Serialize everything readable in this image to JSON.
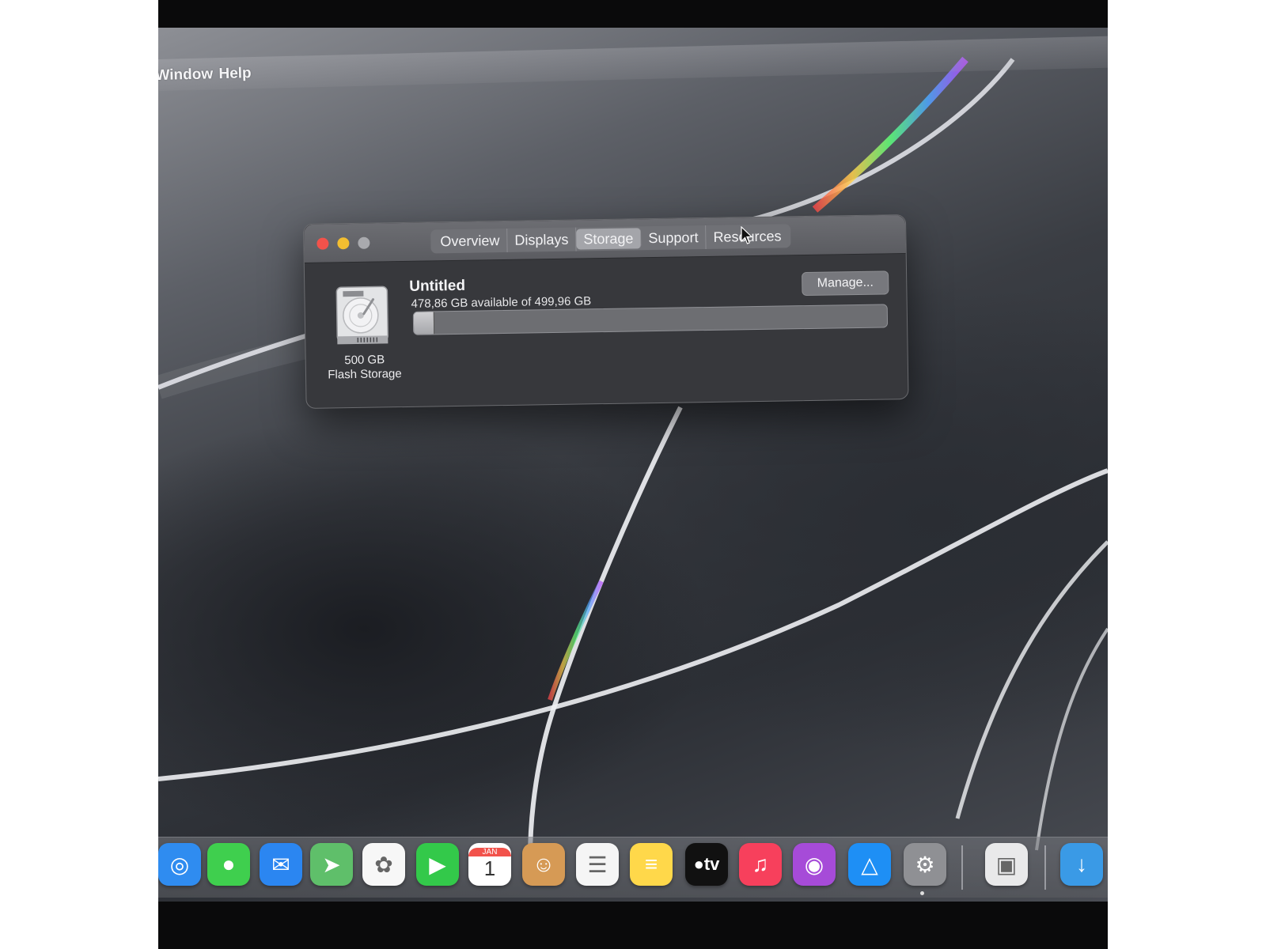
{
  "menubar": {
    "items": [
      "Window",
      "Help"
    ]
  },
  "window": {
    "tabs": [
      {
        "label": "Overview"
      },
      {
        "label": "Displays"
      },
      {
        "label": "Storage"
      },
      {
        "label": "Support"
      },
      {
        "label": "Resources"
      }
    ],
    "active_tab": "Storage",
    "disk": {
      "size_label": "500 GB",
      "type_label": "Flash Storage",
      "icon": "hard-drive-icon"
    },
    "volume": {
      "name": "Untitled",
      "availability": "478,86 GB available of 499,96 GB",
      "used_fraction": 0.042
    },
    "manage_label": "Manage..."
  },
  "dock": {
    "apps": [
      {
        "name": "safari-icon",
        "color": "#2f8cf0"
      },
      {
        "name": "messages-icon",
        "color": "#3fcf4e"
      },
      {
        "name": "mail-icon",
        "color": "#2b86f1"
      },
      {
        "name": "maps-icon",
        "color": "#5fbf6a"
      },
      {
        "name": "photos-icon",
        "color": "#f7f7f7"
      },
      {
        "name": "facetime-icon",
        "color": "#33c94a"
      },
      {
        "name": "calendar-icon",
        "color": "#ffffff",
        "month": "JAN",
        "day": "1"
      },
      {
        "name": "contacts-icon",
        "color": "#d69a55"
      },
      {
        "name": "reminders-icon",
        "color": "#f5f5f5"
      },
      {
        "name": "notes-icon",
        "color": "#ffd84a"
      },
      {
        "name": "tv-icon",
        "color": "#111111",
        "label": "tv"
      },
      {
        "name": "music-icon",
        "color": "#f7405c"
      },
      {
        "name": "podcasts-icon",
        "color": "#a64bd8"
      },
      {
        "name": "app-store-icon",
        "color": "#1e8ff5"
      },
      {
        "name": "system-settings-icon",
        "color": "#8f9094"
      },
      {
        "name": "system-information-icon",
        "color": "#e9e9ea"
      },
      {
        "name": "downloads-folder-icon",
        "color": "#3a9ae6"
      }
    ]
  },
  "colors": {
    "close": "#f2524b",
    "minimize": "#f3be30",
    "zoom": "#a9aaae"
  }
}
